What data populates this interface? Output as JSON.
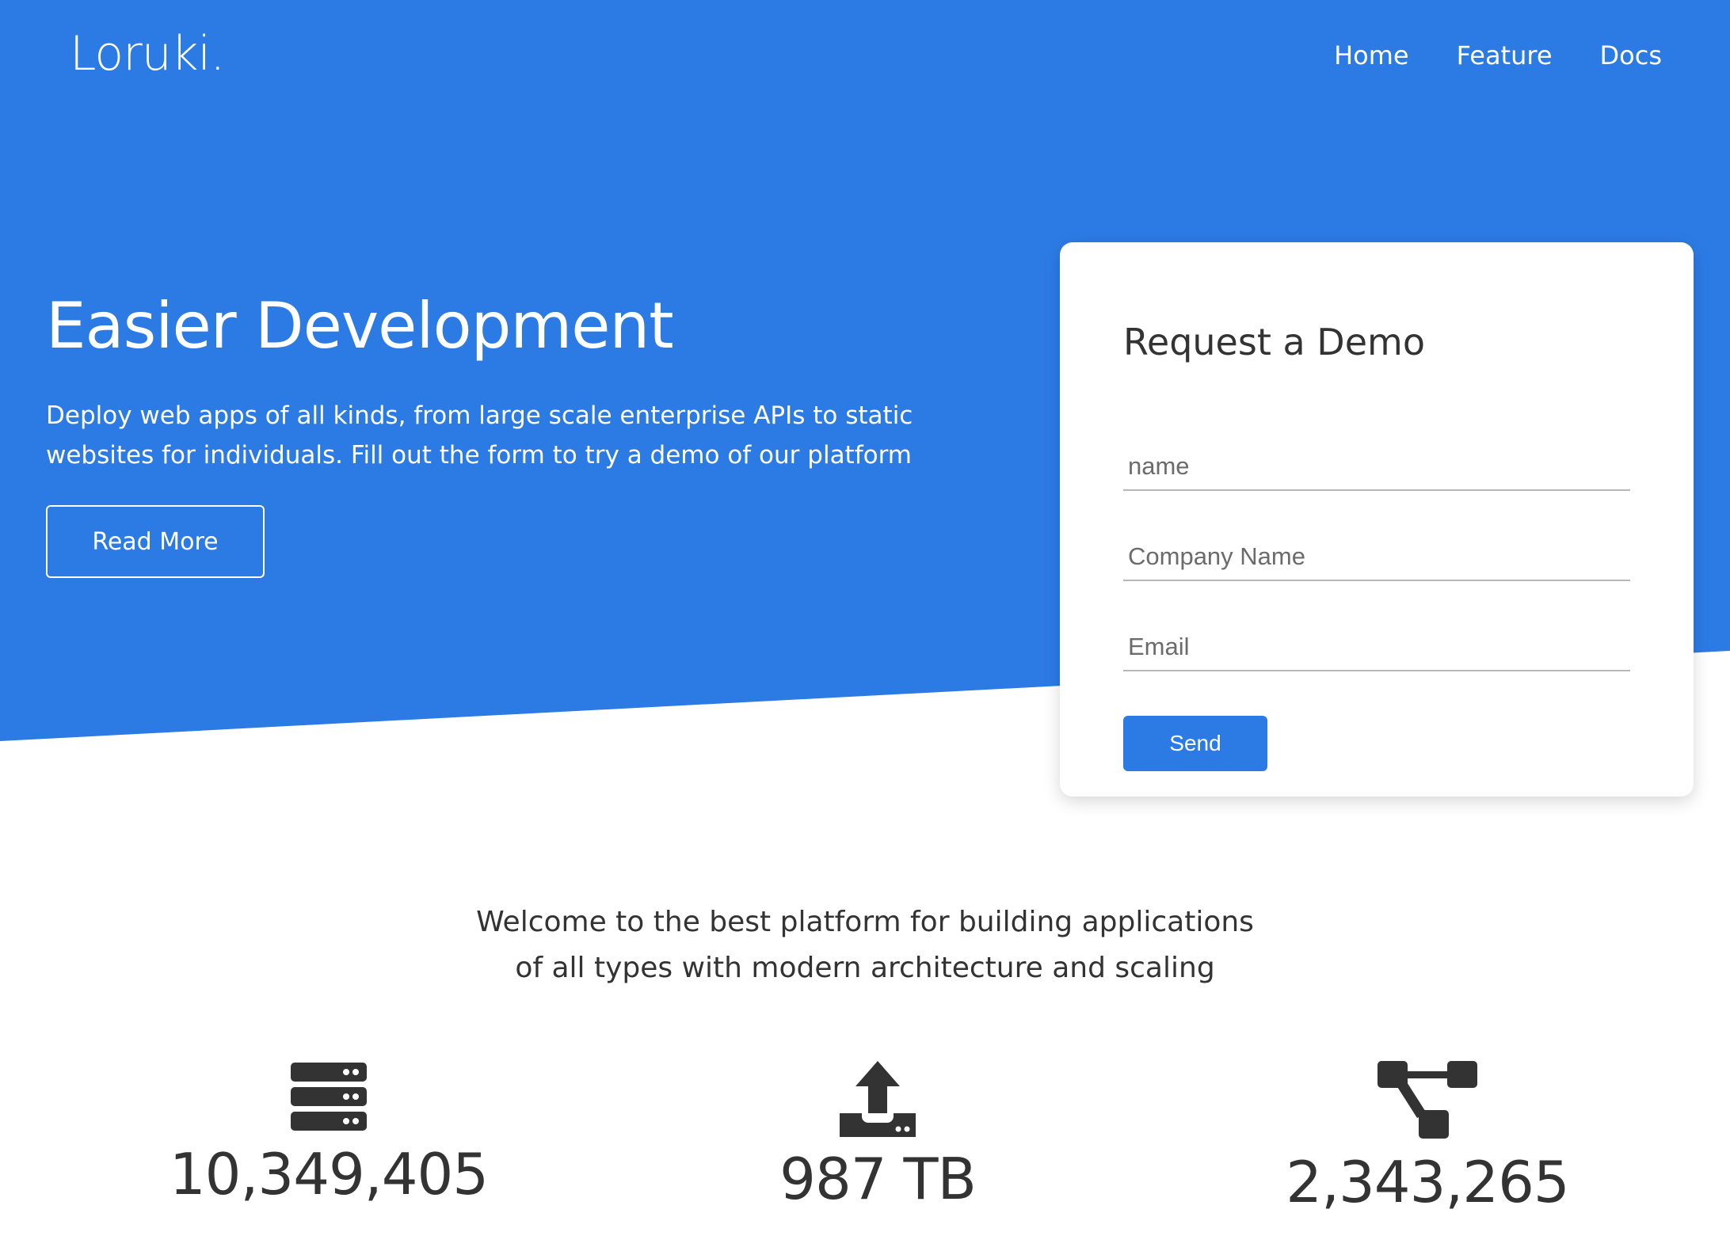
{
  "brand": {
    "logo": "Loruki."
  },
  "nav": {
    "items": [
      "Home",
      "Feature",
      "Docs"
    ]
  },
  "hero": {
    "title": "Easier Development",
    "text": "Deploy web apps of all kinds, from large scale enterprise APIs to static websites for individuals. Fill out the form to try a demo of our platform",
    "button_label": "Read More"
  },
  "demo_form": {
    "title": "Request a Demo",
    "fields": [
      {
        "placeholder": "name"
      },
      {
        "placeholder": "Company Name"
      },
      {
        "placeholder": "Email"
      }
    ],
    "submit_label": "Send"
  },
  "welcome": {
    "text": "Welcome to the best platform for building applications of all types with modern architecture and scaling"
  },
  "stats": [
    {
      "icon": "server-icon",
      "value": "10,349,405"
    },
    {
      "icon": "upload-icon",
      "value": "987 TB"
    },
    {
      "icon": "project-diagram-icon",
      "value": "2,343,265"
    }
  ],
  "colors": {
    "primary": "#2c7be5",
    "text": "#333333",
    "background": "#ffffff"
  }
}
